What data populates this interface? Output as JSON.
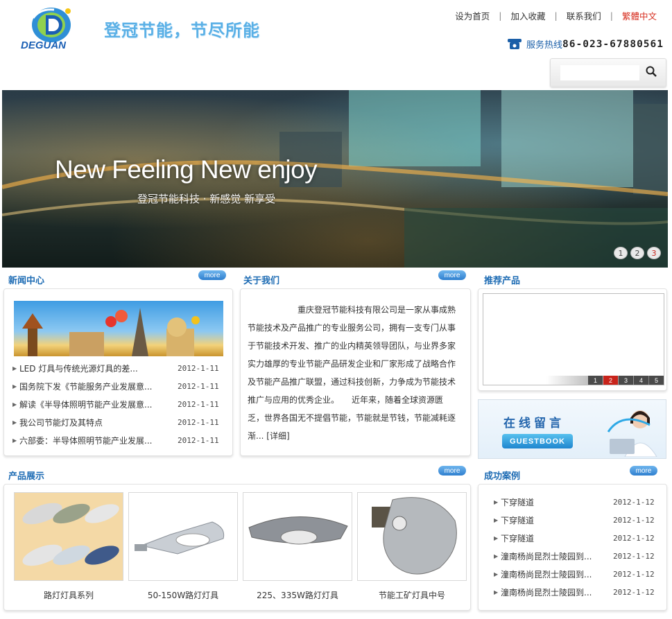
{
  "header": {
    "logo_text": "DEGUAN",
    "slogan": "登冠节能，节尽所能",
    "links": [
      "设为首页",
      "加入收藏",
      "联系我们",
      "繁體中文"
    ],
    "hotline_label": "服务热线",
    "hotline_number": "86-023-67880561",
    "search_value": ""
  },
  "banner": {
    "headline": "New Feeling   New enjoy",
    "subline": "登冠节能科技 · 新感觉  新享受",
    "pages": [
      "1",
      "2",
      "3"
    ],
    "active_page": "3"
  },
  "news": {
    "title": "新闻中心",
    "more": "more",
    "items": [
      {
        "title": "LED 灯具与传统光源灯具的差...",
        "date": "2012-1-11"
      },
      {
        "title": "国务院下发《节能服务产业发展意...",
        "date": "2012-1-11"
      },
      {
        "title": "解读《半导体照明节能产业发展意...",
        "date": "2012-1-11"
      },
      {
        "title": "我公司节能灯及其特点",
        "date": "2012-1-11"
      },
      {
        "title": "六部委：半导体照明节能产业发展...",
        "date": "2012-1-11"
      }
    ]
  },
  "about": {
    "title": "关于我们",
    "more": "more",
    "text": "重庆登冠节能科技有限公司是一家从事成熟节能技术及产品推广的专业服务公司，拥有一支专门从事于节能技术开发、推广的业内精英领导团队，与业界多家实力雄厚的专业节能产品研发企业和厂家形成了战略合作及节能产品推广联盟，通过科技创新，力争成为节能技术推广与应用的优秀企业。　　近年来，随着全球资源匮乏，世界各国无不提倡节能，节能就是节钱，节能减耗逐渐...",
    "detail": "[详细]"
  },
  "recommend": {
    "title": "推荐产品",
    "pages": [
      "1",
      "2",
      "3",
      "4",
      "5"
    ],
    "active_page": "2"
  },
  "guestbook": {
    "zh": "在线留言",
    "en": "GUESTBOOK"
  },
  "products": {
    "title": "产品展示",
    "more": "more",
    "items": [
      {
        "name": "路灯灯具系列"
      },
      {
        "name": "50-150W路灯灯具"
      },
      {
        "name": "225、335W路灯灯具"
      },
      {
        "name": "节能工矿灯具中号"
      }
    ]
  },
  "cases": {
    "title": "成功案例",
    "more": "more",
    "items": [
      {
        "title": "下穿隧道",
        "date": "2012-1-12"
      },
      {
        "title": "下穿隧道",
        "date": "2012-1-12"
      },
      {
        "title": "下穿隧道",
        "date": "2012-1-12"
      },
      {
        "title": "潼南杨尚昆烈士陵园到...",
        "date": "2012-1-12"
      },
      {
        "title": "潼南杨尚昆烈士陵园到...",
        "date": "2012-1-12"
      },
      {
        "title": "潼南杨尚昆烈士陵园到...",
        "date": "2012-1-12"
      }
    ]
  },
  "colors": {
    "brand_blue": "#1e6cb4",
    "slogan_blue": "#5ab0e6",
    "accent_red": "#d62b1c"
  }
}
